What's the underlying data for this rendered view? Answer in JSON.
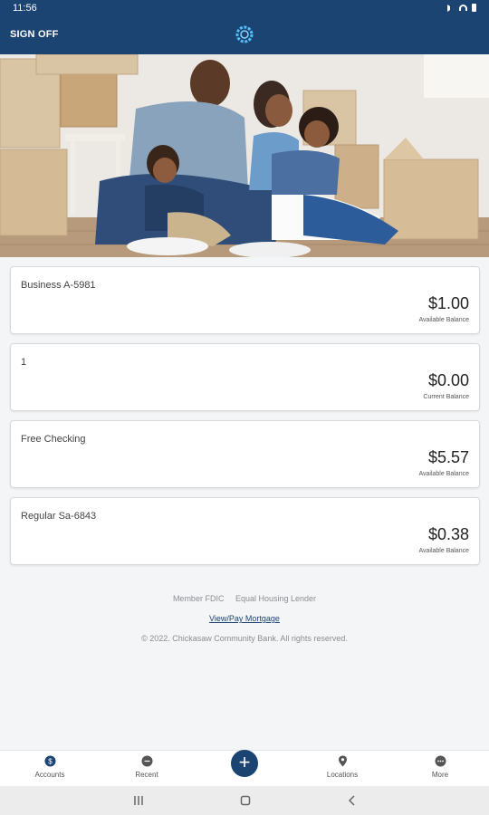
{
  "status_bar": {
    "time": "11:56"
  },
  "header": {
    "signoff_label": "SIGN OFF"
  },
  "accounts": [
    {
      "name": "Business A-5981",
      "amount": "$1.00",
      "label": "Available Balance"
    },
    {
      "name": "1",
      "amount": "$0.00",
      "label": "Current Balance"
    },
    {
      "name": "Free Checking",
      "amount": "$5.57",
      "label": "Available Balance"
    },
    {
      "name": "Regular Sa-6843",
      "amount": "$0.38",
      "label": "Available Balance"
    }
  ],
  "footer": {
    "member_fdic": "Member FDIC",
    "equal_housing": "Equal Housing Lender",
    "mortgage_link": "View/Pay Mortgage",
    "copyright": "© 2022. Chickasaw Community Bank. All rights reserved."
  },
  "bottom_nav": {
    "accounts": "Accounts",
    "recent": "Recent",
    "locations": "Locations",
    "more": "More"
  },
  "colors": {
    "brand": "#1b4472",
    "background": "#f4f5f6"
  }
}
